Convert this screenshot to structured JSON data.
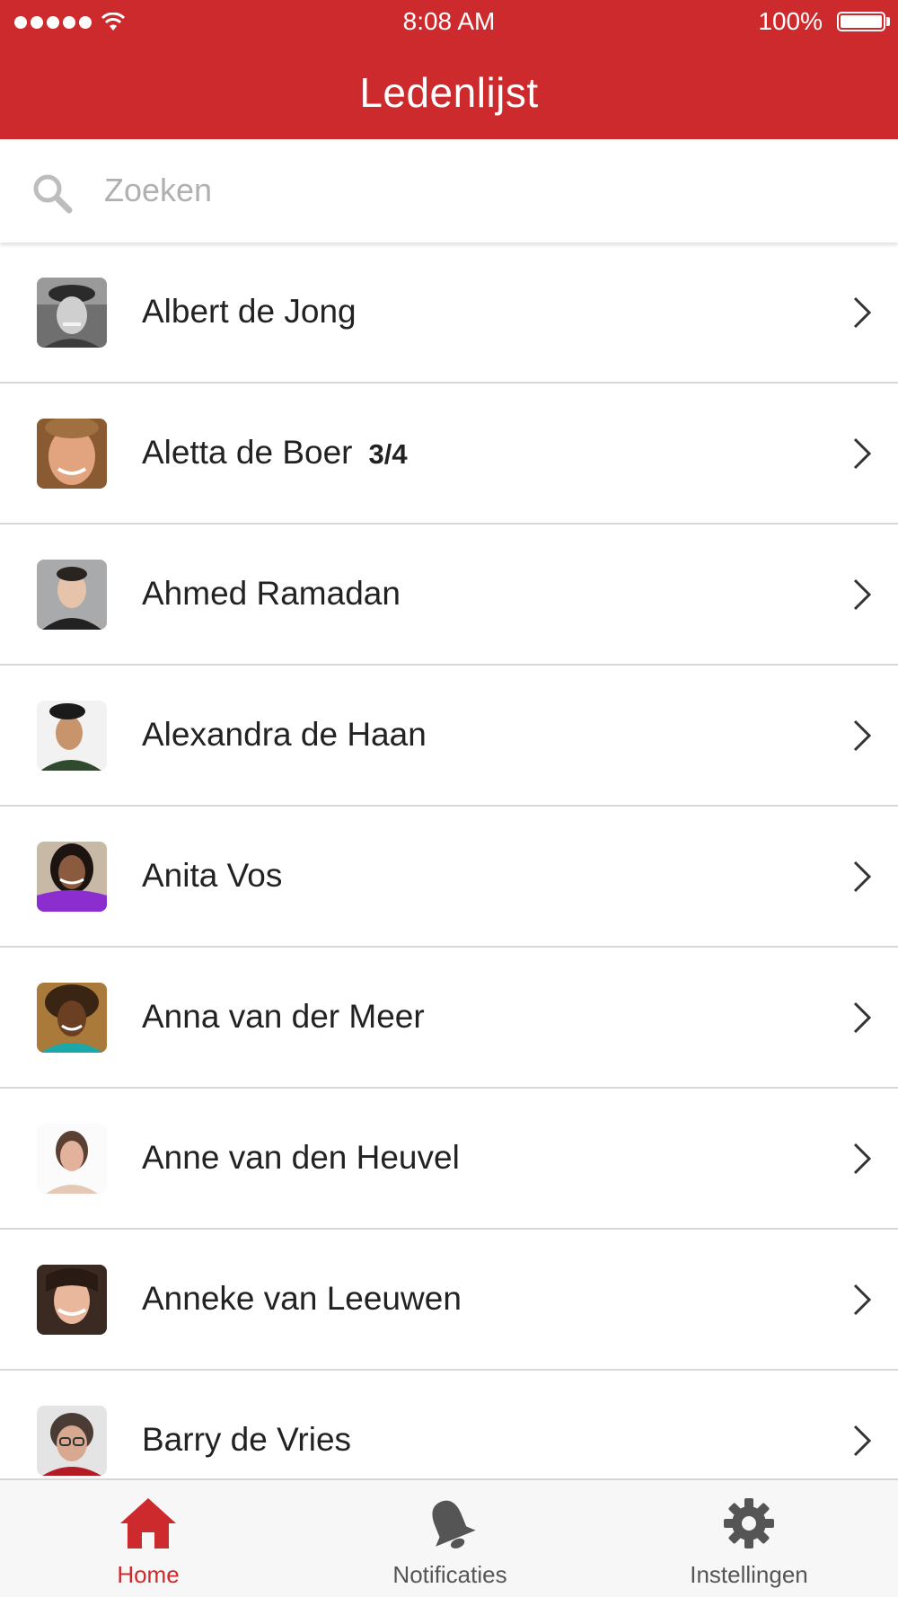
{
  "status_bar": {
    "time": "8:08 AM",
    "battery": "100%"
  },
  "header": {
    "title": "Ledenlijst"
  },
  "search": {
    "placeholder": "Zoeken",
    "icon": "search-icon"
  },
  "members": [
    {
      "name": "Albert de Jong",
      "badge": ""
    },
    {
      "name": "Aletta de Boer",
      "badge": "3/4"
    },
    {
      "name": "Ahmed Ramadan",
      "badge": ""
    },
    {
      "name": "Alexandra de Haan",
      "badge": ""
    },
    {
      "name": "Anita Vos",
      "badge": ""
    },
    {
      "name": "Anna van der Meer",
      "badge": ""
    },
    {
      "name": "Anne van den Heuvel",
      "badge": ""
    },
    {
      "name": "Anneke van Leeuwen",
      "badge": ""
    },
    {
      "name": "Barry de Vries",
      "badge": ""
    }
  ],
  "tabs": [
    {
      "label": "Home",
      "icon": "home-icon",
      "active": true
    },
    {
      "label": "Notificaties",
      "icon": "bell-icon",
      "active": false
    },
    {
      "label": "Instellingen",
      "icon": "gear-icon",
      "active": false
    }
  ],
  "colors": {
    "brand": "#cd2a2e",
    "inactive_tab": "#555555",
    "separator": "#d8d8d8"
  }
}
